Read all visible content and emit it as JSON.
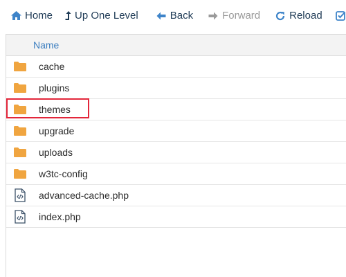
{
  "toolbar": {
    "home_label": "Home",
    "up_label": "Up One Level",
    "back_label": "Back",
    "forward_label": "Forward",
    "reload_label": "Reload"
  },
  "table": {
    "column_name": "Name"
  },
  "files": [
    {
      "name": "cache",
      "type": "folder"
    },
    {
      "name": "plugins",
      "type": "folder"
    },
    {
      "name": "themes",
      "type": "folder",
      "highlighted": true
    },
    {
      "name": "upgrade",
      "type": "folder"
    },
    {
      "name": "uploads",
      "type": "folder"
    },
    {
      "name": "w3tc-config",
      "type": "folder"
    },
    {
      "name": "advanced-cache.php",
      "type": "php-file"
    },
    {
      "name": "index.php",
      "type": "php-file"
    }
  ],
  "colors": {
    "accent": "#3e84c9",
    "folder": "#f0a540",
    "highlight_border": "#e3263a",
    "header_text": "#3a7dbf"
  }
}
